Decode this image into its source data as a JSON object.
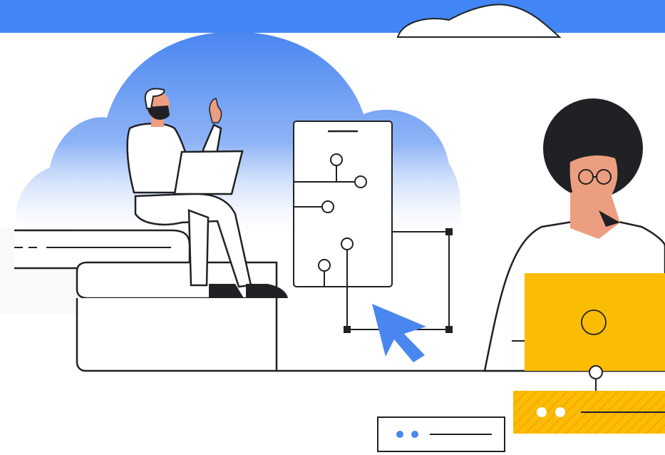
{
  "illustration": {
    "colors": {
      "brand_blue": "#4285f4",
      "cursor_blue": "#4a86f0",
      "accent_yellow": "#fbbc04",
      "skin": "#ec9f80",
      "hair": "#202124",
      "outline": "#202124",
      "sky_light": "#e8f0fe"
    },
    "icons": [
      "cloud-icon",
      "pointer-cursor-icon",
      "laptop-icon",
      "glasses-icon",
      "two-dot-indicator-icon"
    ]
  }
}
